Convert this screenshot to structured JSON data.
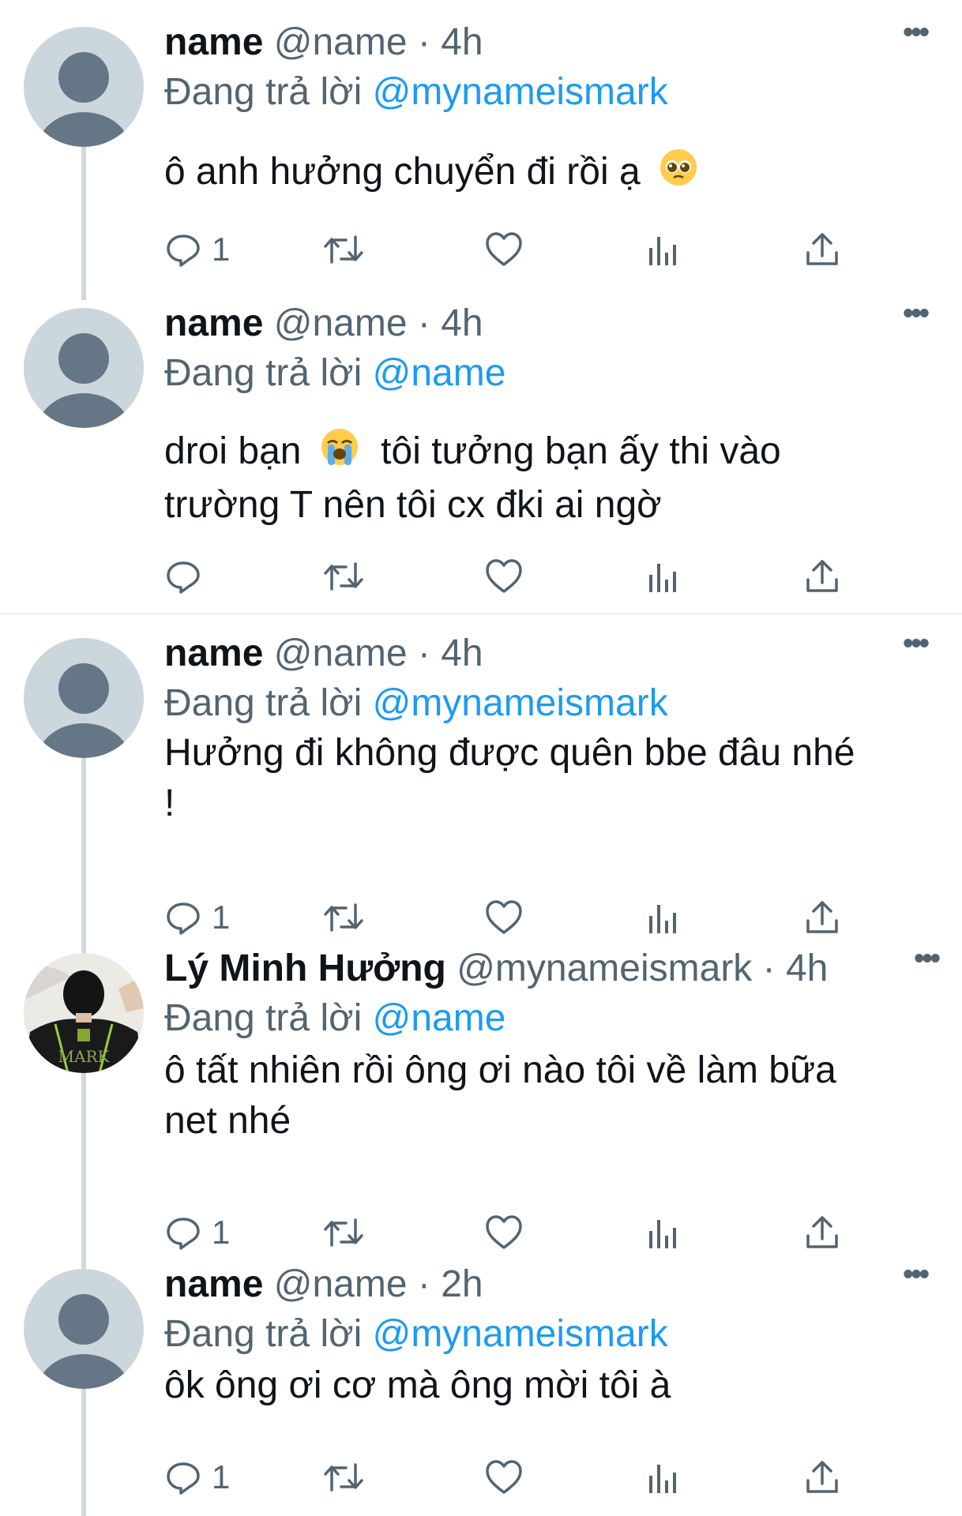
{
  "tweets": [
    {
      "display_name": "name",
      "handle": "@name",
      "time": "4h",
      "replying_label": "Đang trả lời",
      "replying_to": "@mynameismark",
      "text_lines": [
        "ô anh hưởng chuyển đi rồi ạ"
      ],
      "reply_count": "1",
      "avatar": "default-avatar"
    },
    {
      "display_name": "name",
      "handle": "@name",
      "time": "4h",
      "replying_label": "Đang trả lời",
      "replying_to": "@name",
      "text_lines": [
        "droi bạn",
        "tôi tưởng bạn ấy thi vào",
        "trường T nên tôi cx đki ai ngờ"
      ],
      "reply_count": "",
      "avatar": "default-avatar"
    },
    {
      "display_name": "name",
      "handle": "@name",
      "time": "4h",
      "replying_label": "Đang trả lời",
      "replying_to": "@mynameismark",
      "text_lines": [
        "Hưởng đi không được quên bbe đâu nhé",
        "!"
      ],
      "reply_count": "1",
      "avatar": "default-avatar"
    },
    {
      "display_name": "Lý Minh Hưởng",
      "handle": "@mynameismark",
      "time": "4h",
      "replying_label": "Đang trả lời",
      "replying_to": "@name",
      "text_lines": [
        "ô tất nhiên rồi ông ơi nào tôi về làm bữa",
        "net nhé"
      ],
      "reply_count": "1",
      "avatar": "photo-avatar"
    },
    {
      "display_name": "name",
      "handle": "@name",
      "time": "2h",
      "replying_label": "Đang trả lời",
      "replying_to": "@mynameismark",
      "text_lines": [
        "ôk ông ơi cơ mà ông mời tôi à"
      ],
      "reply_count": "1",
      "avatar": "default-avatar"
    }
  ],
  "separator": "·",
  "more_glyph": "•••",
  "icons": [
    "reply-icon",
    "retweet-icon",
    "like-icon",
    "analytics-icon",
    "share-icon",
    "more-options-icon"
  ],
  "colors": {
    "link": "#1d9bf0",
    "secondary_text": "#536471",
    "avatar_bg": "#ccd6dd",
    "avatar_fg": "#657786",
    "thread_line": "#cfd9de"
  },
  "emojis": [
    "pleading-face-emoji",
    "loudly-crying-face-emoji"
  ],
  "jersey_text": "MARK"
}
